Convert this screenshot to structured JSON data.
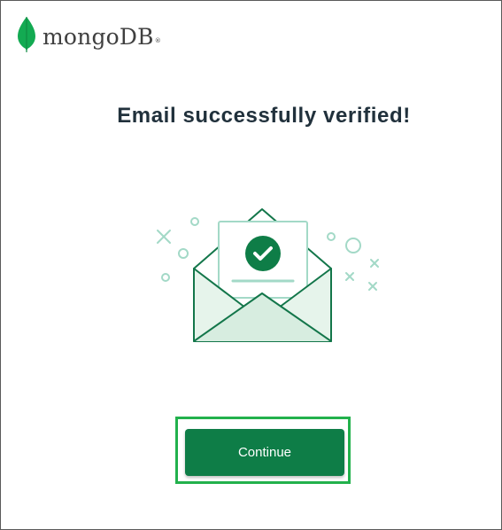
{
  "brand": {
    "name": "mongoDB",
    "registered_mark": "®",
    "leaf_color": "#13aa52",
    "leaf_dark_color": "#0f8a42"
  },
  "main": {
    "headline": "Email successfully verified!",
    "illustration_icon": "envelope-with-check-icon",
    "continue_label": "Continue"
  },
  "colors": {
    "primary_button": "#0e7d47",
    "headline_text": "#21313c",
    "illustration_stroke": "#13764a",
    "illustration_fill": "#e6f4eb",
    "highlight_border": "#22b14c"
  }
}
